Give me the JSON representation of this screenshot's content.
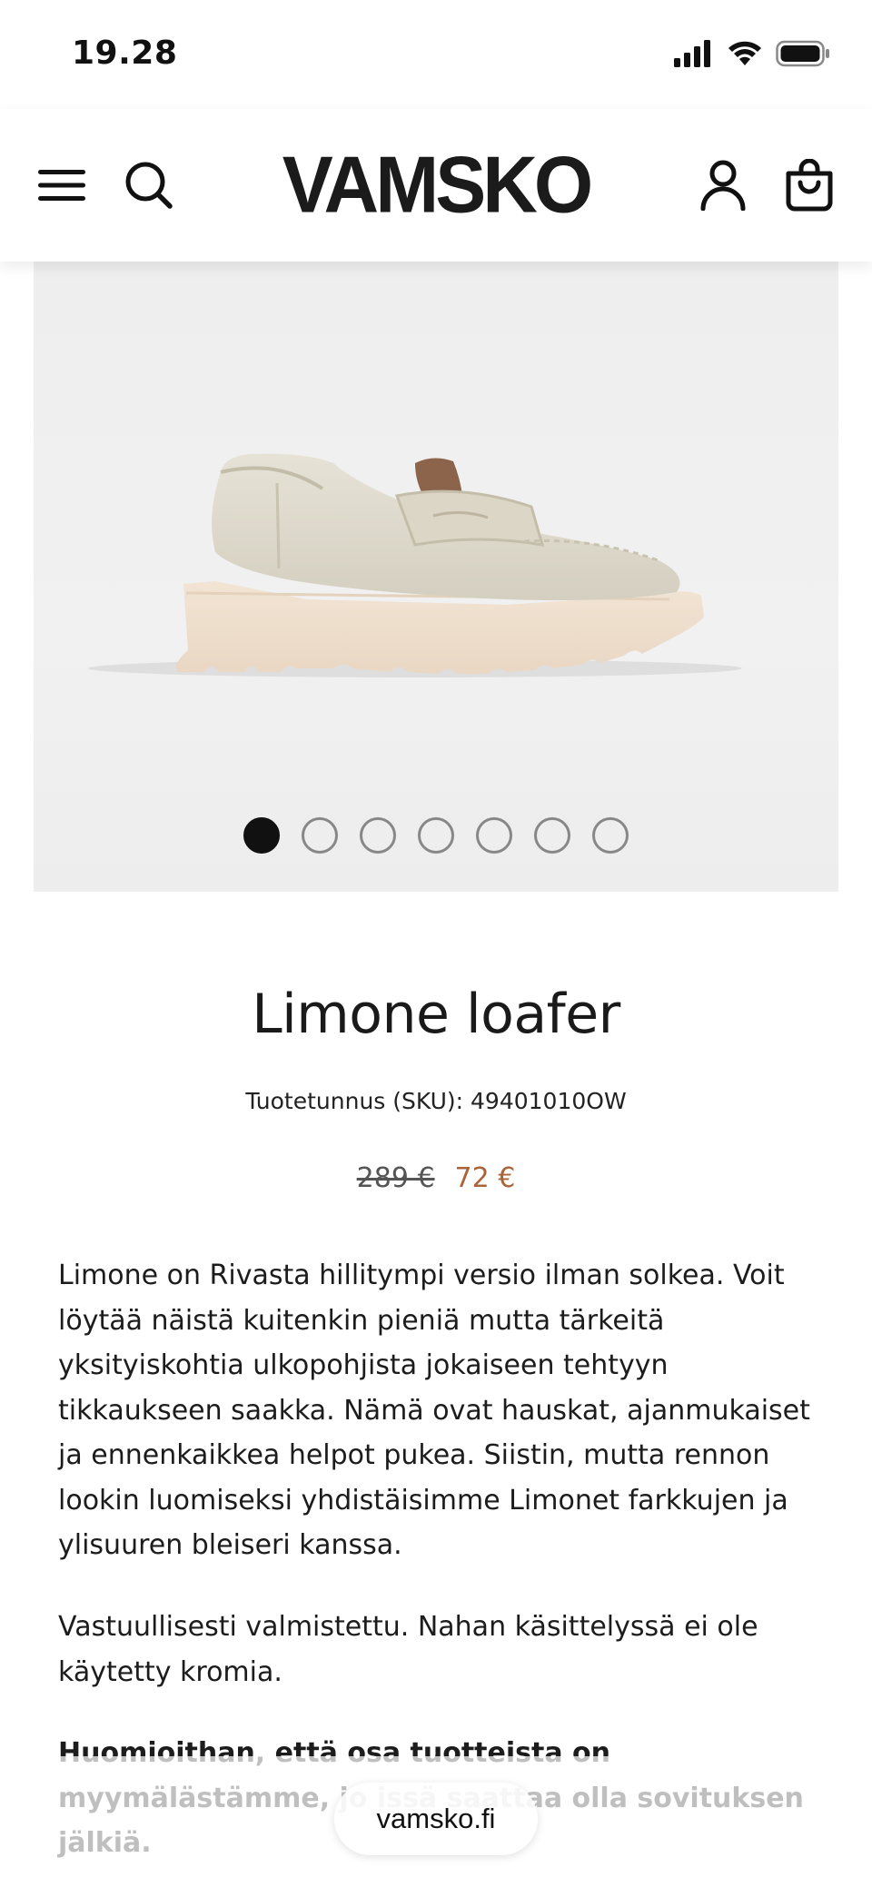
{
  "status_bar": {
    "time": "19.28"
  },
  "header": {
    "logo": "VAMSKO",
    "menu_icon": "hamburger-menu-icon",
    "search_icon": "search-icon",
    "account_icon": "user-icon",
    "cart_icon": "shopping-bag-icon"
  },
  "gallery": {
    "image": "cream leather loafer with chunky scalloped sole",
    "slide_count": 7,
    "active_slide": 1
  },
  "product": {
    "title": "Limone loafer",
    "sku": "Tuotetunnus (SKU): 49401010OW",
    "price_original": "289 €",
    "price_sale": "72 €",
    "description_1": "Limone on Rivasta hillitympi versio ilman solkea. Voit löytää näistä kuitenkin pieniä mutta tärkeitä yksityiskohtia ulkopohjista jokaiseen tehtyyn tikkaukseen saakka. Nämä ovat hauskat, ajanmukaiset ja ennenkaikkea helpot pukea. Siistin, mutta rennon lookin luomiseksi yhdistäisimme Limonet farkkujen ja ylisuuren bleiseri kanssa.",
    "description_2": "Vastuullisesti valmistettu. Nahan käsittelyssä ei ole käytetty kromia.",
    "description_3": "Huomioithan, että osa tuotteista on myymälästämme, jo                      issä saattaa olla sovituksen jälkiä."
  },
  "browser": {
    "url": "vamsko.fi"
  },
  "colors": {
    "sale_price": "#a9643a",
    "text": "#1a1a1a",
    "gallery_bg": "#eeeeee"
  }
}
